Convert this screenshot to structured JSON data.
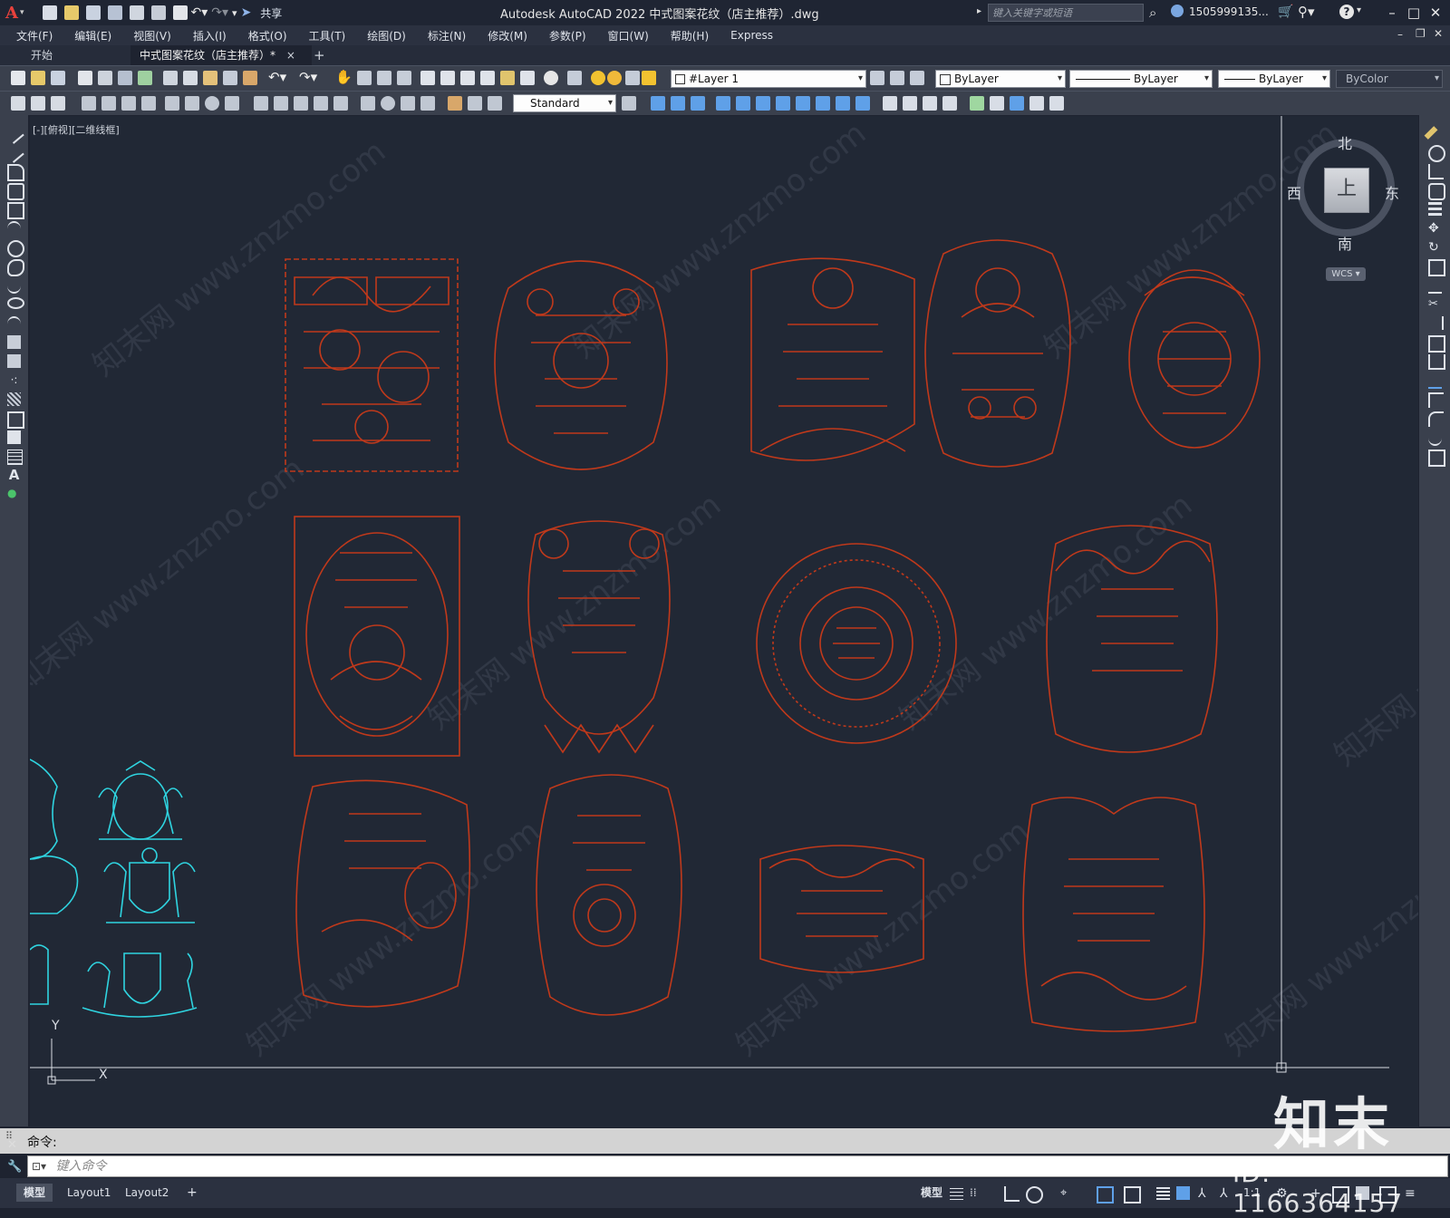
{
  "titlebar": {
    "app_letter": "A",
    "share": "共享",
    "title": "Autodesk AutoCAD 2022    中式图案花纹（店主推荐）.dwg",
    "search_placeholder": "键入关键字或短语",
    "user": "1505999135...",
    "help": "?"
  },
  "menu": [
    "文件(F)",
    "编辑(E)",
    "视图(V)",
    "插入(I)",
    "格式(O)",
    "工具(T)",
    "绘图(D)",
    "标注(N)",
    "修改(M)",
    "参数(P)",
    "窗口(W)",
    "帮助(H)",
    "Express"
  ],
  "tabs": {
    "start": "开始",
    "active": "中式图案花纹（店主推荐）*",
    "close": "×",
    "add": "+"
  },
  "properties": {
    "layer": "#Layer 1",
    "color": "ByLayer",
    "linetype": "ByLayer",
    "lineweight": "ByLayer",
    "plotstyle": "ByColor",
    "text_style": "Standard"
  },
  "viewport_label": "[-][俯视][二维线框]",
  "viewcube": {
    "north": "北",
    "south": "南",
    "east": "东",
    "west": "西",
    "face": "上",
    "wcs": "WCS"
  },
  "ucs": {
    "x": "X",
    "y": "Y"
  },
  "watermark": "知末网 www.znzmo.com",
  "command": {
    "history": "命令:",
    "placeholder": "键入命令"
  },
  "layout_tabs": [
    "模型",
    "Layout1",
    "Layout2"
  ],
  "status": {
    "model": "模型",
    "scale": "1:1"
  },
  "brand": {
    "logo": "知末",
    "id": "ID: 1166364157"
  },
  "colors": {
    "pattern_red": "#c0391b",
    "pattern_cyan": "#2fd4e0",
    "canvas": "#212835"
  }
}
